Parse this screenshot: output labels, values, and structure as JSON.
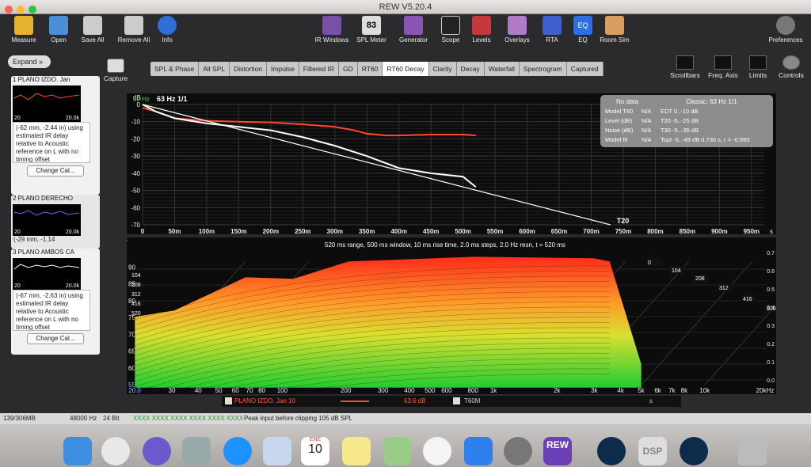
{
  "window": {
    "title": "REW V5.20.4"
  },
  "toolbar": {
    "measure": "Measure",
    "open": "Open",
    "save_all": "Save All",
    "remove_all": "Remove All",
    "info": "Info",
    "ir_windows": "IR Windows",
    "spl_meter": "SPL Meter",
    "spl_meter_value": "83",
    "generator": "Generator",
    "scope": "Scope",
    "levels": "Levels",
    "overlays": "Overlays",
    "rta": "RTA",
    "eq": "EQ",
    "room_sim": "Room Sim",
    "preferences": "Preferences"
  },
  "left": {
    "expand": "Expand",
    "measurements": [
      {
        "name": "1 PLANO IZDO. Jan",
        "x_from": "20",
        "x_to": "20.0k",
        "notes": "(-62 mm, -2.44 in) using estimated IR delay relative to Acoustic reference on L with no timing offset",
        "button": "Change Cal..."
      },
      {
        "name": "2 PLANO DERECHO",
        "x_from": "20",
        "x_to": "20.0k",
        "notes": "(-29 mm, -1.14",
        "button": ""
      },
      {
        "name": "3 PLANO AMBOS CA",
        "x_from": "20",
        "x_to": "20.0k",
        "notes": "(-67 mm, -2.63 in) using estimated IR delay relative to Acoustic reference on L with no timing offset",
        "button": "Change Cal..."
      }
    ]
  },
  "capture": "Capture",
  "tabs": [
    "SPL & Phase",
    "All SPL",
    "Distortion",
    "Impulse",
    "Filtered IR",
    "GD",
    "RT60",
    "RT60 Decay",
    "Clarity",
    "Decay",
    "Waterfall",
    "Spectrogram",
    "Captured"
  ],
  "active_tab": "RT60 Decay",
  "right_buttons": {
    "scrollbars": "Scrollbars",
    "freq_axis": "Freq. Axis",
    "limits": "Limits",
    "controls": "Controls"
  },
  "rt60": {
    "freq_label": "20 Hz",
    "band": "63 Hz 1/1",
    "info_header_left": "No data",
    "info_header_right": "Classic: 63 Hz 1/1",
    "info_rows": [
      {
        "label": "Model T60",
        "val": "N/A",
        "right": "EDT  0..-10 dB"
      },
      {
        "label": "Level (dB)",
        "val": "N/A",
        "right": "T20  -5..-25 dB"
      },
      {
        "label": "Noise (dB)",
        "val": "N/A",
        "right": "T30  -5..-35 dB"
      },
      {
        "label": "Model fit",
        "val": "N/A",
        "right": "Topt -5..-49 dB  0.730 s, r = -0.993"
      }
    ],
    "t20_label": "T20",
    "y_unit": "dB",
    "x_unit": "s",
    "colors": {
      "measured": "#ff4a2a",
      "schroeder": "#ffffff",
      "fit": "#ffffff"
    }
  },
  "chart_data": [
    {
      "type": "line",
      "title": "",
      "ylabel": "dB",
      "xlabel": "s",
      "ylim": [
        -70,
        0
      ],
      "xlim": [
        0,
        0.97
      ],
      "y_ticks": [
        "0",
        "-10",
        "-20",
        "-30",
        "-40",
        "-50",
        "-60",
        "-70"
      ],
      "x_ticks": [
        "0",
        "50m",
        "100m",
        "150m",
        "200m",
        "250m",
        "300m",
        "350m",
        "400m",
        "450m",
        "500m",
        "550m",
        "600m",
        "650m",
        "700m",
        "750m",
        "800m",
        "850m",
        "900m",
        "950m"
      ],
      "series": [
        {
          "name": "",
          "x": [
            0,
            0.02,
            0.05,
            0.1,
            0.15,
            0.2,
            0.25,
            0.3,
            0.33,
            0.35,
            0.38,
            0.4,
            0.45,
            0.5,
            0.52
          ],
          "y": [
            -2,
            -4,
            -8,
            -9.5,
            -10,
            -10.5,
            -11.5,
            -13,
            -15,
            -17,
            -18,
            -18,
            -17.5,
            -17.5,
            -18
          ]
        },
        {
          "name": "",
          "x": [
            0,
            0.02,
            0.05,
            0.1,
            0.15,
            0.2,
            0.25,
            0.3,
            0.35,
            0.4,
            0.45,
            0.5,
            0.52
          ],
          "y": [
            0,
            -4,
            -8,
            -11,
            -13,
            -15,
            -19,
            -24,
            -30,
            -37,
            -40,
            -42,
            -48
          ]
        },
        {
          "name": "",
          "x": [
            0,
            0.73
          ],
          "y": [
            0,
            -70
          ]
        }
      ]
    },
    {
      "type": "area",
      "title": "520 ms range, 500 ms window, 10 ms rise time, 2.0 ms steps, 2.0 Hz resn, t = 520 ms",
      "ylabel": "SPL",
      "xlabel": "",
      "ylim": [
        55,
        95
      ],
      "y_ticks": [
        "90",
        "85",
        "80",
        "75",
        "70",
        "65",
        "60",
        "55.0"
      ],
      "x_ticks": [
        "20.0",
        "30",
        "40",
        "50",
        "60",
        "70",
        "80",
        "100",
        "200",
        "300",
        "400",
        "500",
        "600",
        "800",
        "1k",
        "2k",
        "3k",
        "4k",
        "5k",
        "6k",
        "7k",
        "8k",
        "10k",
        "20kHz"
      ],
      "depth_ticks": [
        "0",
        "104",
        "208",
        "312",
        "416",
        "520"
      ],
      "z_ticks": [
        "0.7",
        "0.6",
        "0.5",
        "0.4",
        "0.3",
        "0.2",
        "0.1",
        "0.0"
      ],
      "z_unit": "s",
      "left_labels": [
        "104",
        "208",
        "312",
        "416",
        "520"
      ]
    }
  ],
  "legend": {
    "name": "PLANO IZDO. Jan 10",
    "value": "63.6 dB",
    "t60": "T60M",
    "unit": "s"
  },
  "status": {
    "mem": "139/306MB",
    "rate": "48000 Hz",
    "bits": "24 Bit",
    "xxx": "XXXX XXXX   XXXX XXXX   XXXX XXXX",
    "peak": "Peak input before clipping 105 dB SPL"
  },
  "dock": {
    "calendar_month": "ENE",
    "calendar_day": "10",
    "rew": "REW",
    "dsp": "DSP"
  }
}
